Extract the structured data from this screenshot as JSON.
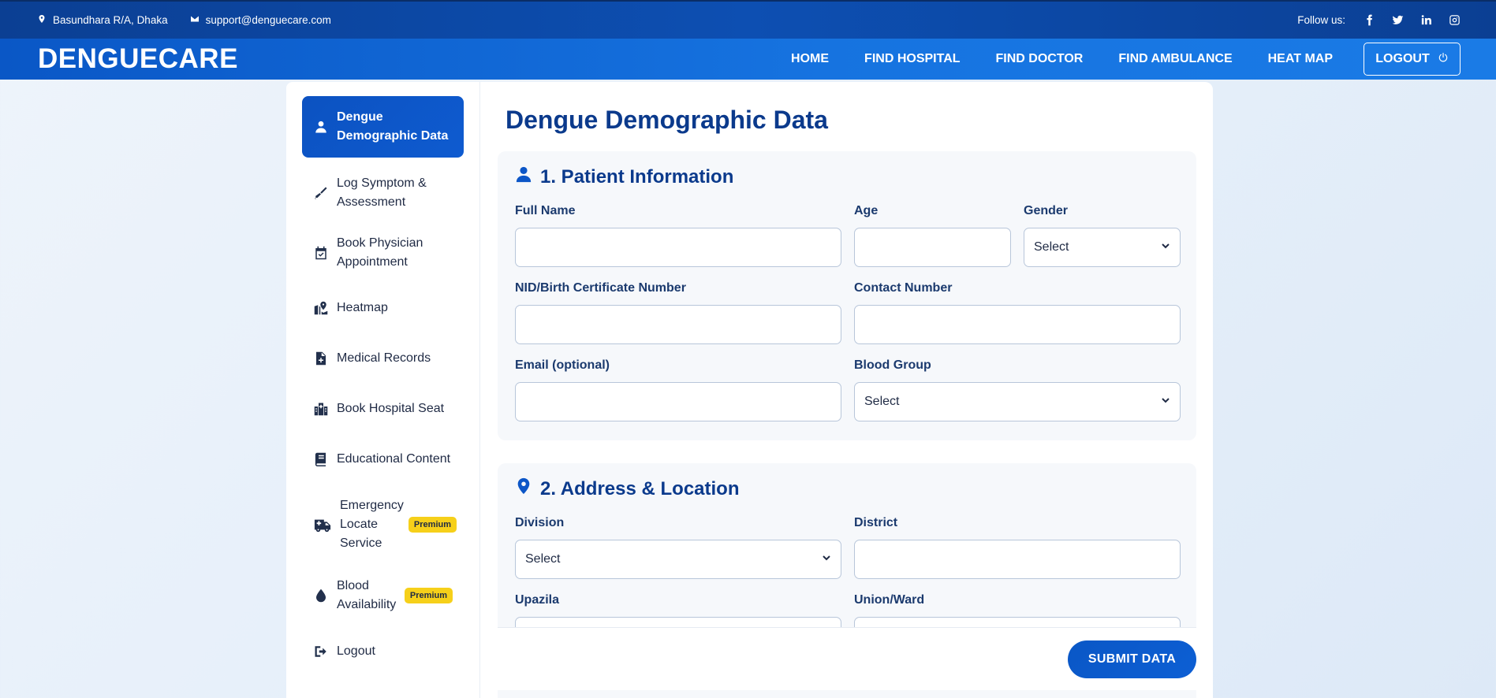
{
  "topbar": {
    "location": "Basundhara R/A, Dhaka",
    "email": "support@denguecare.com",
    "follow_label": "Follow us:"
  },
  "navbar": {
    "brand": "DENGUECARE",
    "items": [
      "HOME",
      "FIND HOSPITAL",
      "FIND DOCTOR",
      "FIND AMBULANCE",
      "HEAT MAP"
    ],
    "logout_label": "LOGOUT"
  },
  "sidebar": {
    "items": [
      {
        "label": "Dengue Demographic Data",
        "icon": "user-icon"
      },
      {
        "label": "Log Symptom & Assessment",
        "icon": "thermometer-icon"
      },
      {
        "label": "Book Physician Appointment",
        "icon": "calendar-check-icon"
      },
      {
        "label": "Heatmap",
        "icon": "map-pin-icon"
      },
      {
        "label": "Medical Records",
        "icon": "medical-file-icon"
      },
      {
        "label": "Book Hospital Seat",
        "icon": "hospital-icon"
      },
      {
        "label": "Educational Content",
        "icon": "book-icon"
      },
      {
        "label": "Emergency Locate Service",
        "icon": "ambulance-icon",
        "badge": "Premium"
      },
      {
        "label": "Blood Availability",
        "icon": "blood-drop-icon",
        "badge": "Premium"
      },
      {
        "label": "Logout",
        "icon": "sign-out-icon"
      }
    ]
  },
  "main": {
    "title": "Dengue Demographic Data",
    "section1": {
      "title": "1. Patient Information",
      "full_name_label": "Full Name",
      "age_label": "Age",
      "gender_label": "Gender",
      "gender_value": "Select",
      "nid_label": "NID/Birth Certificate Number",
      "contact_label": "Contact Number",
      "email_label": "Email (optional)",
      "blood_group_label": "Blood Group",
      "blood_group_value": "Select"
    },
    "section2": {
      "title": "2. Address & Location",
      "division_label": "Division",
      "division_value": "Select",
      "district_label": "District",
      "upazila_label": "Upazila",
      "union_label": "Union/Ward"
    },
    "submit_label": "SUBMIT DATA"
  }
}
